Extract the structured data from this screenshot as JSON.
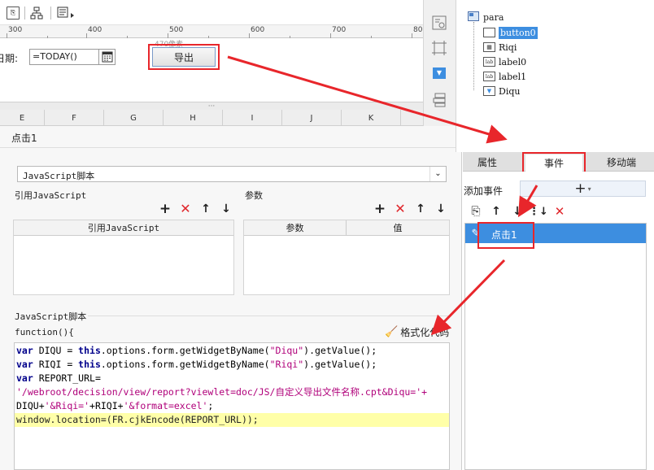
{
  "toolbar": {
    "icons": [
      "copy-icon",
      "tree-icon",
      "form-icon"
    ]
  },
  "ruler": {
    "ticks": [
      "300",
      "400",
      "500",
      "600",
      "700",
      "80"
    ]
  },
  "form": {
    "date_label": "日期:",
    "date_value": "=TODAY()",
    "button_label": "导出",
    "size_hint": "470像素"
  },
  "grid": {
    "columns": [
      "E",
      "F",
      "G",
      "H",
      "I",
      "J",
      "K"
    ]
  },
  "event_panel": {
    "title": "点击1",
    "script_type": "JavaScript脚本",
    "ref_js_label": "引用JavaScript",
    "params_label": "参数",
    "ref_js_col": "引用JavaScript",
    "params_col": "参数",
    "value_col": "值",
    "js_section_label": "JavaScript脚本",
    "function_header": "function(){",
    "format_button": "格式化代码"
  },
  "code": {
    "line1_kw": "var",
    "line1_a": " DIQU = ",
    "line1_this": "this",
    "line1_b": ".options.form.getWidgetByName(",
    "line1_str": "\"Diqu\"",
    "line1_c": ").getValue();",
    "line2_kw": "var",
    "line2_a": " RIQI = ",
    "line2_this": "this",
    "line2_b": ".options.form.getWidgetByName(",
    "line2_str": "\"Riqi\"",
    "line2_c": ").getValue();",
    "line3_kw": "var",
    "line3_a": " REPORT_URL=",
    "line4_str": "'/webroot/decision/view/report?viewlet=doc/JS/自定义导出文件名称.cpt&Diqu='+",
    "line5_a": "DIQU+",
    "line5_str1": "'&Riqi='",
    "line5_b": "+RIQI+",
    "line5_str2": "'&format=excel'",
    "line5_c": ";",
    "line6": "window.location=(FR.cjkEncode(REPORT_URL));"
  },
  "tree": {
    "root": "para",
    "items": [
      {
        "label": "button0",
        "icon": "button-widget-icon",
        "selected": true
      },
      {
        "label": "Riqi",
        "icon": "date-widget-icon",
        "selected": false
      },
      {
        "label": "label0",
        "icon": "label-widget-icon",
        "selected": false
      },
      {
        "label": "label1",
        "icon": "label-widget-icon",
        "selected": false
      },
      {
        "label": "Diqu",
        "icon": "dropdown-widget-icon",
        "selected": false
      }
    ]
  },
  "right_tabs": [
    "属性",
    "事件",
    "移动端"
  ],
  "add_event_label": "添加事件",
  "event_list": [
    {
      "label": "点击1",
      "selected": true
    }
  ],
  "colors": {
    "accent": "#3d8ee0",
    "highlight": "#ffffa8",
    "annotation": "#e8262b"
  }
}
